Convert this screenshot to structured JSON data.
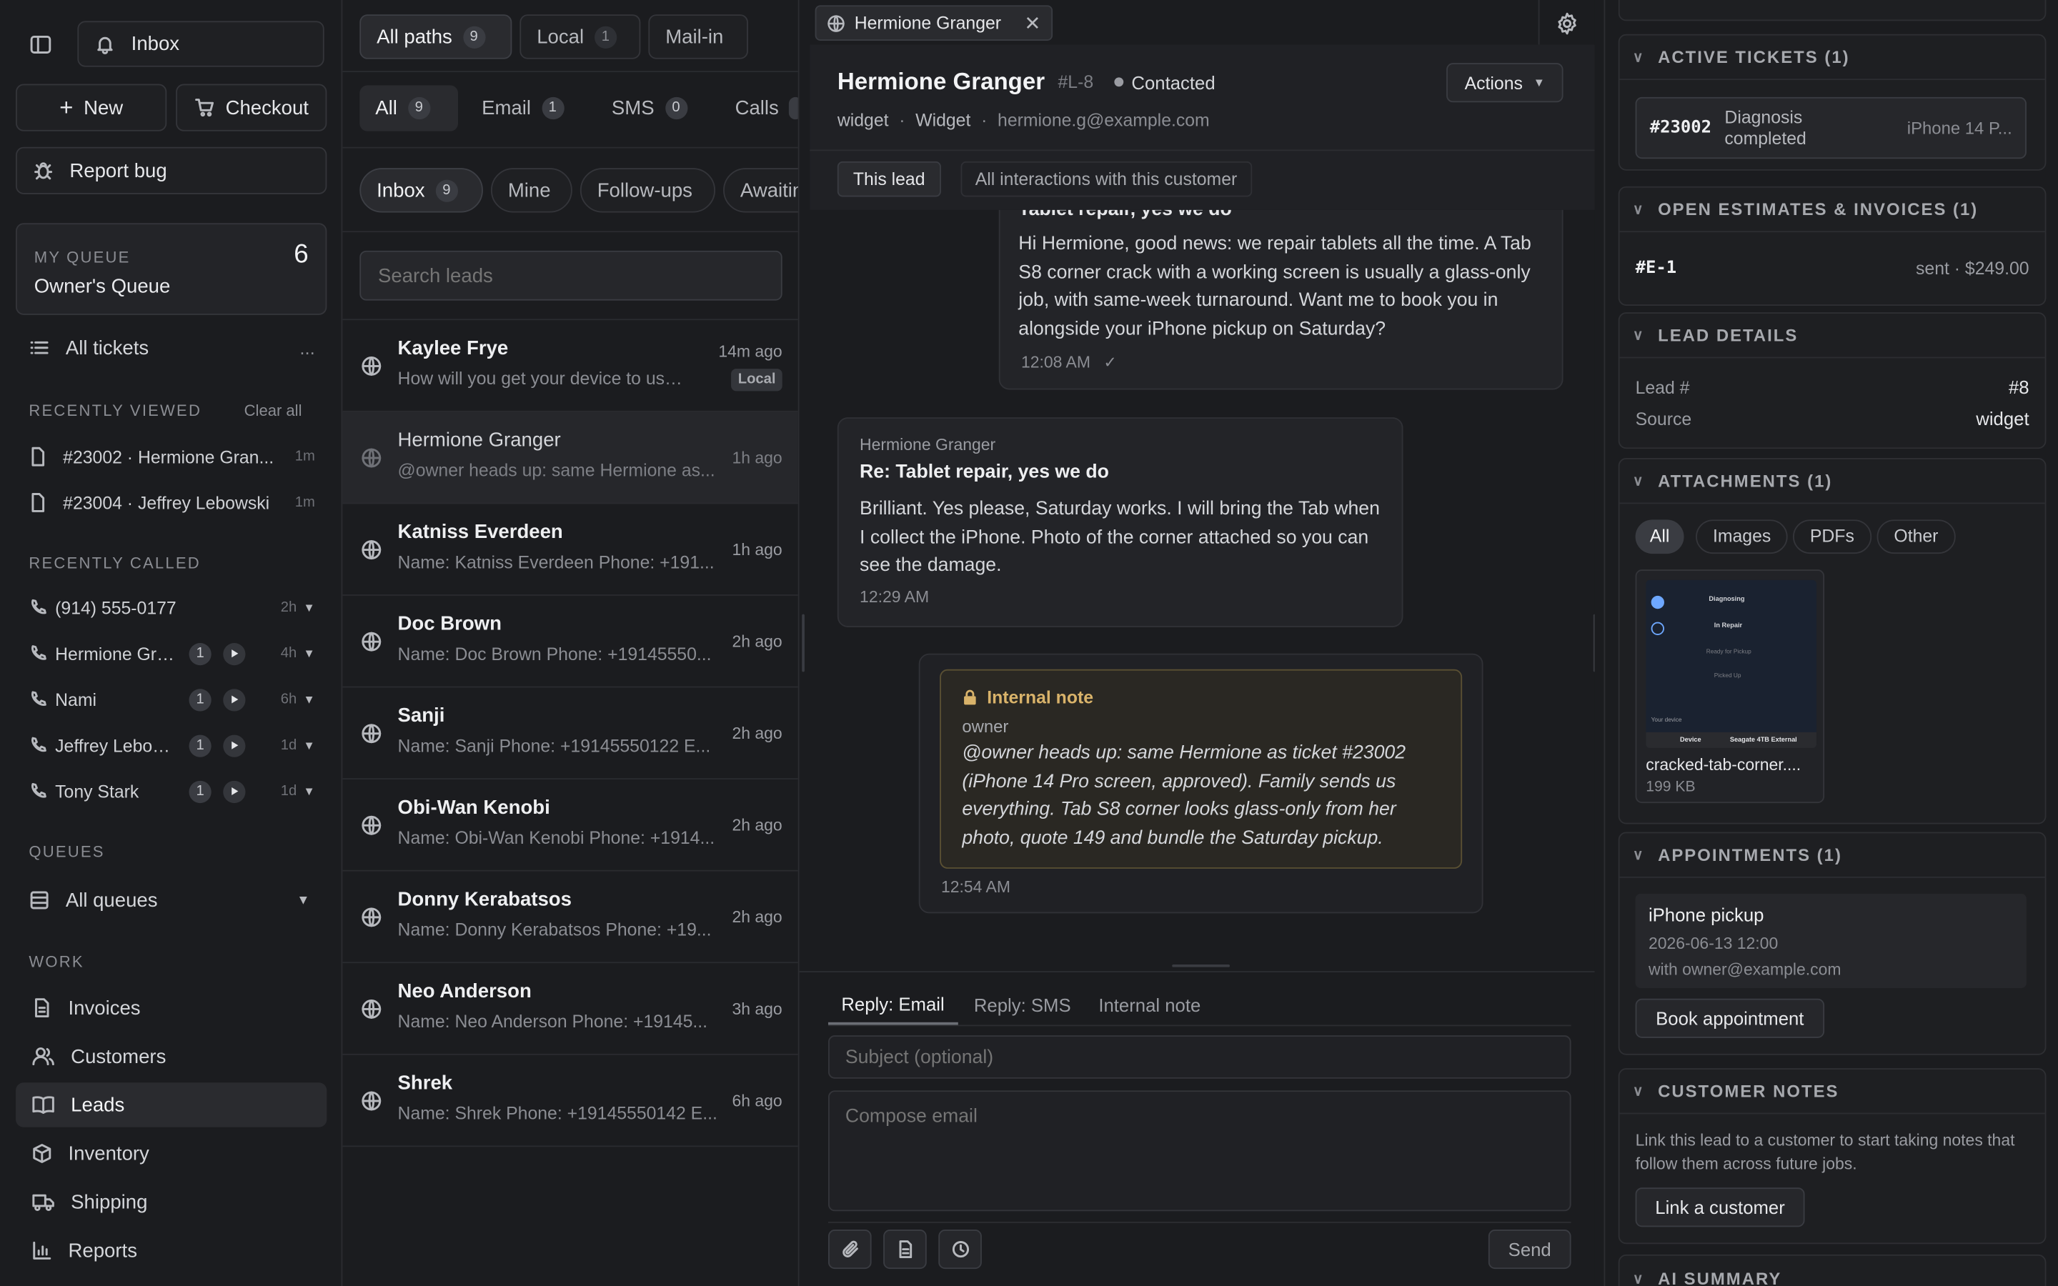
{
  "sidebar": {
    "inbox_label": "Inbox",
    "new_label": "New",
    "checkout_label": "Checkout",
    "report_bug_label": "Report bug",
    "queue": {
      "caption": "MY QUEUE",
      "name": "Owner's Queue",
      "count": "6"
    },
    "all_tickets_label": "All tickets",
    "all_tickets_more": "...",
    "recently_viewed": {
      "title": "RECENTLY VIEWED",
      "clear_label": "Clear all",
      "items": [
        {
          "label": "#23002 · Hermione Gran...",
          "time": "1m"
        },
        {
          "label": "#23004 · Jeffrey Lebowski",
          "time": "1m"
        }
      ]
    },
    "recently_called": {
      "title": "RECENTLY CALLED",
      "items": [
        {
          "label": "(914) 555-0177",
          "count": "",
          "time": "2h"
        },
        {
          "label": "Hermione Gra...",
          "count": "1",
          "time": "4h"
        },
        {
          "label": "Nami",
          "count": "1",
          "time": "6h"
        },
        {
          "label": "Jeffrey Lebow...",
          "count": "1",
          "time": "1d"
        },
        {
          "label": "Tony Stark",
          "count": "1",
          "time": "1d"
        }
      ]
    },
    "queues": {
      "title": "QUEUES",
      "all_label": "All queues"
    },
    "work": {
      "title": "WORK",
      "items": [
        {
          "label": "Invoices"
        },
        {
          "label": "Customers"
        },
        {
          "label": "Leads"
        },
        {
          "label": "Inventory"
        },
        {
          "label": "Shipping"
        },
        {
          "label": "Reports"
        }
      ]
    }
  },
  "leads_panel": {
    "path_tabs": [
      {
        "label": "All paths",
        "count": "9"
      },
      {
        "label": "Local",
        "count": "1"
      },
      {
        "label": "Mail-in",
        "count": ""
      }
    ],
    "channel_tabs": [
      {
        "label": "All",
        "count": "9"
      },
      {
        "label": "Email",
        "count": "1"
      },
      {
        "label": "SMS",
        "count": "0"
      },
      {
        "label": "Calls",
        "count": ""
      }
    ],
    "filter_tabs": [
      {
        "label": "Inbox",
        "count": "9"
      },
      {
        "label": "Mine",
        "count": ""
      },
      {
        "label": "Follow-ups",
        "count": ""
      },
      {
        "label": "Awaiting",
        "count": ""
      }
    ],
    "search_placeholder": "Search leads",
    "items": [
      {
        "name": "Kaylee Frye",
        "preview": "How will you get your device to us?:...",
        "time": "14m ago",
        "tag": "Local"
      },
      {
        "name": "Hermione Granger",
        "preview": "@owner heads up: same Hermione as...",
        "time": "1h ago",
        "tag": ""
      },
      {
        "name": "Katniss Everdeen",
        "preview": "Name: Katniss Everdeen Phone: +191...",
        "time": "1h ago",
        "tag": ""
      },
      {
        "name": "Doc Brown",
        "preview": "Name: Doc Brown Phone: +19145550...",
        "time": "2h ago",
        "tag": ""
      },
      {
        "name": "Sanji",
        "preview": "Name: Sanji Phone: +19145550122 E...",
        "time": "2h ago",
        "tag": ""
      },
      {
        "name": "Obi-Wan Kenobi",
        "preview": "Name: Obi-Wan Kenobi Phone: +1914...",
        "time": "2h ago",
        "tag": ""
      },
      {
        "name": "Donny Kerabatsos",
        "preview": "Name: Donny Kerabatsos Phone: +19...",
        "time": "2h ago",
        "tag": ""
      },
      {
        "name": "Neo Anderson",
        "preview": "Name: Neo Anderson Phone: +19145...",
        "time": "3h ago",
        "tag": ""
      },
      {
        "name": "Shrek",
        "preview": "Name: Shrek Phone: +19145550142 E...",
        "time": "6h ago",
        "tag": ""
      }
    ]
  },
  "conversation": {
    "window_tab": "Hermione Granger",
    "header": {
      "name": "Hermione Granger",
      "lead_id": "#L-8",
      "status": "Contacted",
      "source1": "widget",
      "source2": "Widget",
      "email": "hermione.g@example.com",
      "actions_label": "Actions"
    },
    "scope_tabs": [
      {
        "label": "This lead"
      },
      {
        "label": "All interactions with this customer"
      }
    ],
    "messages": [
      {
        "subject": "Tablet repair, yes we do",
        "body": "Hi Hermione, good news: we repair tablets all the time. A Tab S8 corner crack with a working screen is usually a glass-only job,  with same-week turnaround. Want me to book you in alongside your iPhone pickup on Saturday?",
        "time": "12:08 AM",
        "check": "✓"
      },
      {
        "sender": "Hermione Granger",
        "subject": "Re: Tablet repair, yes we do",
        "body": "Brilliant. Yes please, Saturday works. I will bring the Tab when I collect the iPhone. Photo of the corner attached so you can see the damage.",
        "time": "12:29 AM"
      },
      {
        "label": "Internal note",
        "author": "owner",
        "body": "@owner heads up: same Hermione as ticket #23002 (iPhone 14 Pro screen, approved). Family sends us everything. Tab S8 corner looks glass-only from her photo, quote 149 and bundle the Saturday pickup.",
        "time": "12:54 AM"
      }
    ],
    "reply": {
      "tabs": [
        {
          "label": "Reply: Email"
        },
        {
          "label": "Reply: SMS"
        },
        {
          "label": "Internal note"
        }
      ],
      "subject_placeholder": "Subject (optional)",
      "body_placeholder": "Compose email",
      "send_label": "Send"
    }
  },
  "details": {
    "active_tickets": {
      "title": "ACTIVE TICKETS (1)",
      "items": [
        {
          "id": "#23002",
          "status": "Diagnosis completed",
          "device": "iPhone 14 P..."
        }
      ]
    },
    "estimates": {
      "title": "OPEN ESTIMATES & INVOICES (1)",
      "items": [
        {
          "id": "#E-1",
          "info": "sent · $249.00"
        }
      ]
    },
    "lead_details": {
      "title": "LEAD DETAILS",
      "rows": [
        {
          "label": "Lead #",
          "value": "#8"
        },
        {
          "label": "Source",
          "value": "widget"
        }
      ]
    },
    "attachments": {
      "title": "ATTACHMENTS (1)",
      "filters": [
        {
          "label": "All"
        },
        {
          "label": "Images"
        },
        {
          "label": "PDFs"
        },
        {
          "label": "Other"
        }
      ],
      "file": {
        "name": "cracked-tab-corner....",
        "size": "199 KB",
        "thumb_lines": [
          "Diagnosing",
          "In Repair",
          "Ready for Pickup",
          "Picked Up",
          "Your device",
          "Device",
          "Seagate 4TB External"
        ]
      }
    },
    "appointments": {
      "title": "APPOINTMENTS (1)",
      "item": {
        "title": "iPhone pickup",
        "when": "2026-06-13 12:00",
        "with": "with owner@example.com"
      },
      "book_label": "Book appointment"
    },
    "customer_notes": {
      "title": "CUSTOMER NOTES",
      "text": "Link this lead to a customer to start taking notes that follow them across future jobs.",
      "link_label": "Link a customer"
    },
    "ai_summary": {
      "title": "AI SUMMARY"
    }
  },
  "colors": {
    "accent": "#6ea8ff",
    "note": "#d9b36a",
    "status_dot": "#9a9ca2"
  }
}
